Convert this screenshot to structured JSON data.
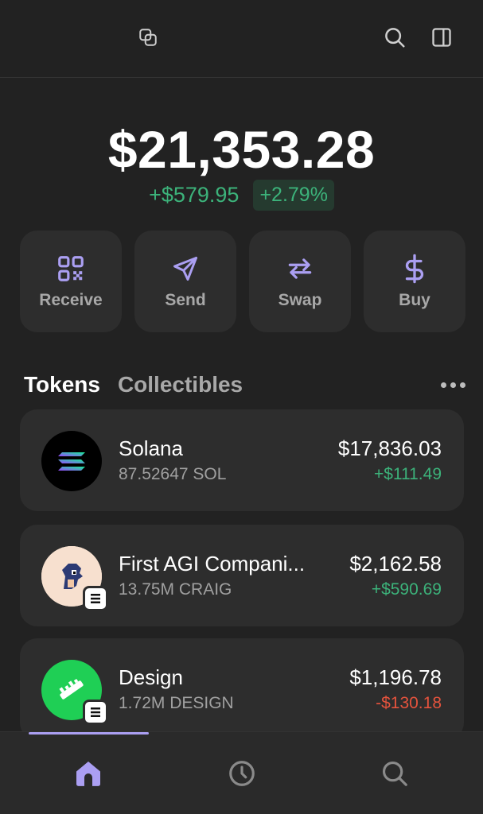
{
  "header": {
    "icons": [
      "copy-icon",
      "search-icon",
      "sidebar-panel-icon"
    ]
  },
  "portfolio": {
    "balance": "$21,353.28",
    "change_amount": "+$579.95",
    "change_percent": "+2.79%"
  },
  "actions": [
    {
      "label": "Receive",
      "icon": "qr-code-icon"
    },
    {
      "label": "Send",
      "icon": "send-icon"
    },
    {
      "label": "Swap",
      "icon": "swap-icon"
    },
    {
      "label": "Buy",
      "icon": "dollar-icon"
    }
  ],
  "tabs": [
    {
      "label": "Tokens",
      "active": true
    },
    {
      "label": "Collectibles",
      "active": false
    }
  ],
  "tokens": [
    {
      "name": "Solana",
      "amount": "87.52647 SOL",
      "value": "$17,836.03",
      "change": "+$111.49",
      "direction": "up",
      "logo": "solana-logo"
    },
    {
      "name": "First AGI Compani...",
      "amount": "13.75M CRAIG",
      "value": "$2,162.58",
      "change": "+$590.69",
      "direction": "up",
      "logo": "craig-logo"
    },
    {
      "name": "Design",
      "amount": "1.72M DESIGN",
      "value": "$1,196.78",
      "change": "-$130.18",
      "direction": "down",
      "logo": "design-logo"
    }
  ],
  "bottom_nav": [
    {
      "icon": "home-icon",
      "active": true
    },
    {
      "icon": "history-icon",
      "active": false
    },
    {
      "icon": "search-icon",
      "active": false
    }
  ],
  "colors": {
    "background": "#222222",
    "card": "#2d2d2d",
    "accent": "#ab9ff2",
    "positive": "#3cb27a",
    "negative": "#e5533d",
    "muted_text": "#a8a8a8"
  }
}
